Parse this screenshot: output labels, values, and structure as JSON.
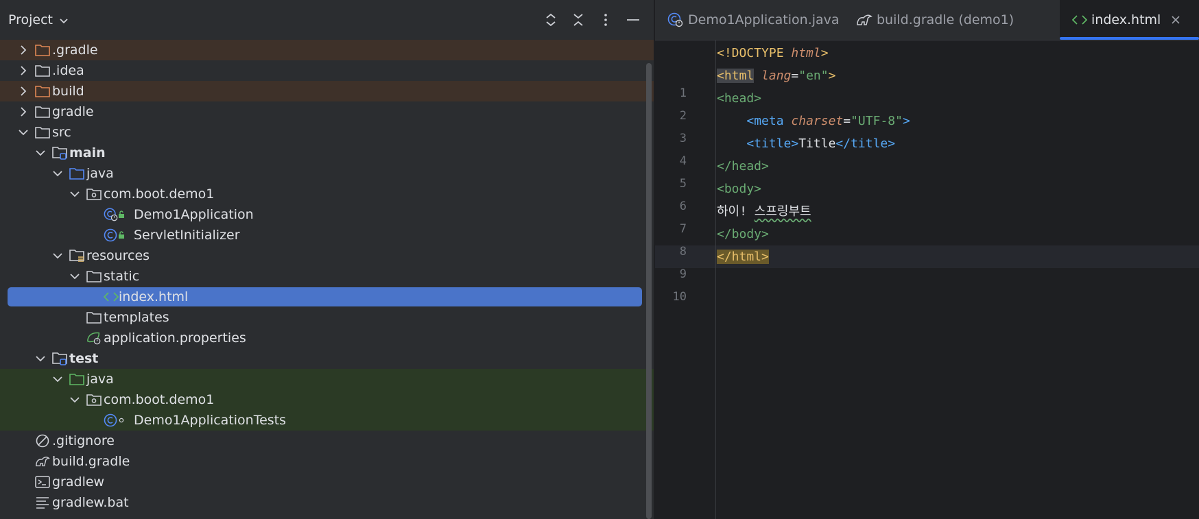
{
  "project_panel": {
    "title": "Project",
    "tools": [
      "expand-all-icon",
      "collapse-all-icon",
      "more-icon",
      "minimize-icon"
    ],
    "tree": [
      {
        "label": ".gradle",
        "indent": 0,
        "expanded": false,
        "icon": "folder-excluded-icon",
        "style": "ignored"
      },
      {
        "label": ".idea",
        "indent": 0,
        "expanded": false,
        "icon": "folder-icon",
        "style": ""
      },
      {
        "label": "build",
        "indent": 0,
        "expanded": false,
        "icon": "folder-excluded-icon",
        "style": "ignored"
      },
      {
        "label": "gradle",
        "indent": 0,
        "expanded": false,
        "icon": "folder-icon",
        "style": ""
      },
      {
        "label": "src",
        "indent": 0,
        "expanded": true,
        "icon": "folder-icon",
        "style": ""
      },
      {
        "label": "main",
        "indent": 1,
        "expanded": true,
        "icon": "module-folder-icon",
        "style": "bold"
      },
      {
        "label": "java",
        "indent": 2,
        "expanded": true,
        "icon": "source-folder-icon",
        "style": ""
      },
      {
        "label": "com.boot.demo1",
        "indent": 3,
        "expanded": true,
        "icon": "package-icon",
        "style": ""
      },
      {
        "label": "Demo1Application",
        "indent": 4,
        "expanded": null,
        "icon": "spring-class-icon",
        "style": ""
      },
      {
        "label": "ServletInitializer",
        "indent": 4,
        "expanded": null,
        "icon": "class-icon",
        "style": ""
      },
      {
        "label": "resources",
        "indent": 2,
        "expanded": true,
        "icon": "resources-folder-icon",
        "style": ""
      },
      {
        "label": "static",
        "indent": 3,
        "expanded": true,
        "icon": "folder-icon",
        "style": ""
      },
      {
        "label": "index.html",
        "indent": 4,
        "expanded": null,
        "icon": "html-file-icon",
        "style": "selected"
      },
      {
        "label": "templates",
        "indent": 3,
        "expanded": null,
        "icon": "folder-icon",
        "style": ""
      },
      {
        "label": "application.properties",
        "indent": 3,
        "expanded": null,
        "icon": "spring-properties-icon",
        "style": ""
      },
      {
        "label": "test",
        "indent": 1,
        "expanded": true,
        "icon": "module-folder-icon",
        "style": "bold"
      },
      {
        "label": "java",
        "indent": 2,
        "expanded": true,
        "icon": "test-folder-icon",
        "style": "testsrc"
      },
      {
        "label": "com.boot.demo1",
        "indent": 3,
        "expanded": true,
        "icon": "package-icon",
        "style": "testsrc"
      },
      {
        "label": "Demo1ApplicationTests",
        "indent": 4,
        "expanded": null,
        "icon": "test-class-icon",
        "style": "testsrc"
      },
      {
        "label": ".gitignore",
        "indent": 0,
        "expanded": null,
        "icon": "gitignore-icon",
        "style": ""
      },
      {
        "label": "build.gradle",
        "indent": 0,
        "expanded": null,
        "icon": "gradle-icon",
        "style": ""
      },
      {
        "label": "gradlew",
        "indent": 0,
        "expanded": null,
        "icon": "terminal-file-icon",
        "style": ""
      },
      {
        "label": "gradlew.bat",
        "indent": 0,
        "expanded": null,
        "icon": "text-file-icon",
        "style": ""
      }
    ]
  },
  "editor": {
    "tabs": [
      {
        "label": "Demo1Application.java",
        "icon": "spring-class-icon",
        "active": false
      },
      {
        "label": "build.gradle (demo1)",
        "icon": "gradle-icon",
        "active": false
      },
      {
        "label": "index.html",
        "icon": "html-file-icon",
        "active": true
      }
    ],
    "current_line": 10,
    "lines": [
      {
        "n": "1",
        "parts": [
          [
            "t-tag",
            "<!DOCTYPE "
          ],
          [
            "t-attr",
            "html"
          ],
          [
            "t-tag",
            ">"
          ]
        ]
      },
      {
        "n": "2",
        "parts": [
          [
            "t-tag hl",
            "<html"
          ],
          [
            "t-plain",
            " "
          ],
          [
            "t-attr",
            "lang"
          ],
          [
            "t-plain",
            "="
          ],
          [
            "t-str",
            "\"en\""
          ],
          [
            "t-tag",
            ">"
          ]
        ]
      },
      {
        "n": "3",
        "parts": [
          [
            "t-html",
            "<head>"
          ]
        ]
      },
      {
        "n": "4",
        "parts": [
          [
            "t-plain",
            "    "
          ],
          [
            "t-kw",
            "<meta "
          ],
          [
            "t-attr",
            "charset"
          ],
          [
            "t-plain",
            "="
          ],
          [
            "t-str",
            "\"UTF-8\""
          ],
          [
            "t-kw",
            ">"
          ]
        ]
      },
      {
        "n": "5",
        "parts": [
          [
            "t-plain",
            "    "
          ],
          [
            "t-kw",
            "<title>"
          ],
          [
            "t-plain",
            "Title"
          ],
          [
            "t-kw",
            "</title>"
          ]
        ]
      },
      {
        "n": "6",
        "parts": [
          [
            "t-html",
            "</head>"
          ]
        ]
      },
      {
        "n": "7",
        "parts": [
          [
            "t-html",
            "<body>"
          ]
        ]
      },
      {
        "n": "8",
        "parts": [
          [
            "t-plain",
            "하이! "
          ],
          [
            "t-plain wavy",
            "스프링부트"
          ]
        ]
      },
      {
        "n": "9",
        "parts": [
          [
            "t-html",
            "</body>"
          ]
        ]
      },
      {
        "n": "10",
        "parts": [
          [
            "t-tag hlm",
            "</html>"
          ]
        ]
      }
    ]
  },
  "colors": {
    "panel_bg": "#2b2d30",
    "editor_bg": "#1e1f22",
    "selection": "#4a74c9",
    "ignored_row": "#3e3129",
    "test_row": "#2b3a25",
    "accent": "#3574f0"
  }
}
